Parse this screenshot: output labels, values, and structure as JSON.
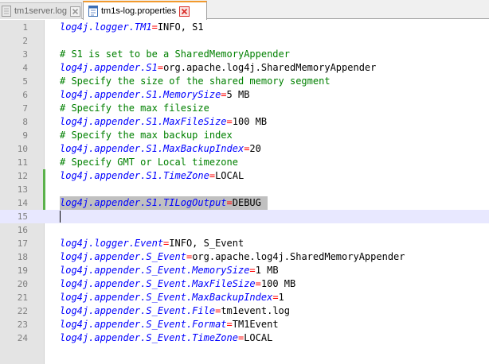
{
  "tabs": [
    {
      "label": "tm1server.log",
      "active": false,
      "icon": "file-icon"
    },
    {
      "label": "tm1s-log.properties",
      "active": true,
      "icon": "file-icon"
    }
  ],
  "colors": {
    "key": "#0000ff",
    "equals": "#ff0000",
    "comment": "#008000",
    "change_marker": "#5ab14a",
    "tab_accent": "#f29a2e",
    "close_icon": "#d9302c"
  },
  "lines": [
    {
      "n": "1",
      "key": "log4j.logger.TM1",
      "eq": "=",
      "val": "INFO, S1"
    },
    {
      "n": "2"
    },
    {
      "n": "3",
      "comment": "# S1 is set to be a SharedMemoryAppender"
    },
    {
      "n": "4",
      "key": "log4j.appender.S1",
      "eq": "=",
      "val": "org.apache.log4j.SharedMemoryAppender"
    },
    {
      "n": "5",
      "comment": "# Specify the size of the shared memory segment"
    },
    {
      "n": "6",
      "key": "log4j.appender.S1.MemorySize",
      "eq": "=",
      "val": "5 MB"
    },
    {
      "n": "7",
      "comment": "# Specify the max filesize"
    },
    {
      "n": "8",
      "key": "log4j.appender.S1.MaxFileSize",
      "eq": "=",
      "val": "100 MB"
    },
    {
      "n": "9",
      "comment": "# Specify the max backup index"
    },
    {
      "n": "10",
      "key": "log4j.appender.S1.MaxBackupIndex",
      "eq": "=",
      "val": "20"
    },
    {
      "n": "11",
      "comment": "# Specify GMT or Local timezone"
    },
    {
      "n": "12",
      "key": "log4j.appender.S1.TimeZone",
      "eq": "=",
      "val": "LOCAL",
      "changed": true
    },
    {
      "n": "13",
      "changed": true
    },
    {
      "n": "14",
      "key": "log4j.appender.S1.TILogOutput",
      "eq": "=",
      "val": "DEBUG",
      "changed": true,
      "selected": true
    },
    {
      "n": "15",
      "current": true
    },
    {
      "n": "16"
    },
    {
      "n": "17",
      "key": "log4j.logger.Event",
      "eq": "=",
      "val": "INFO, S_Event"
    },
    {
      "n": "18",
      "key": "log4j.appender.S_Event",
      "eq": "=",
      "val": "org.apache.log4j.SharedMemoryAppender"
    },
    {
      "n": "19",
      "key": "log4j.appender.S_Event.MemorySize",
      "eq": "=",
      "val": "1 MB"
    },
    {
      "n": "20",
      "key": "log4j.appender.S_Event.MaxFileSize",
      "eq": "=",
      "val": "100 MB"
    },
    {
      "n": "21",
      "key": "log4j.appender.S_Event.MaxBackupIndex",
      "eq": "=",
      "val": "1"
    },
    {
      "n": "22",
      "key": "log4j.appender.S_Event.File",
      "eq": "=",
      "val": "tm1event.log"
    },
    {
      "n": "23",
      "key": "log4j.appender.S_Event.Format",
      "eq": "=",
      "val": "TM1Event"
    },
    {
      "n": "24",
      "key": "log4j.appender.S_Event.TimeZone",
      "eq": "=",
      "val": "LOCAL"
    }
  ]
}
